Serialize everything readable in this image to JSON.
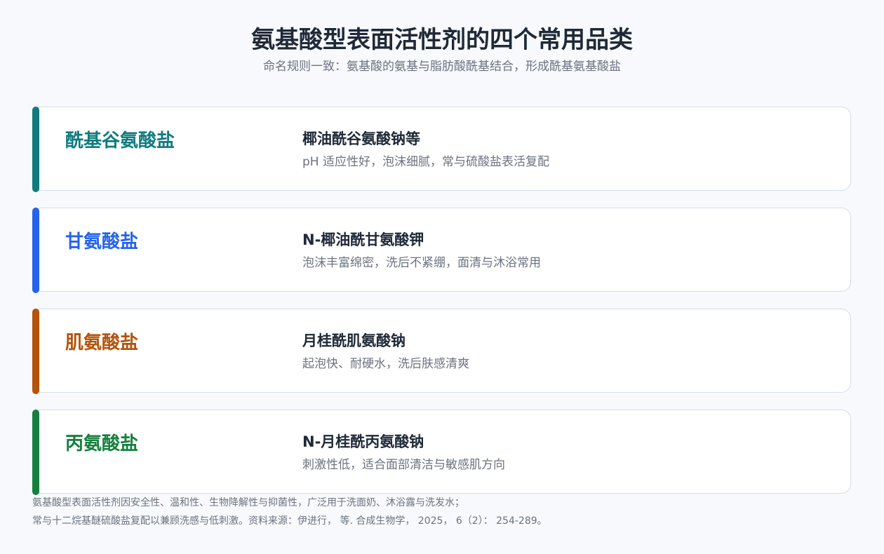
{
  "title": "氨基酸型表面活性剂的四个常用品类",
  "subtitle": "命名规则一致：氨基酸的氨基与脂肪酸酰基结合，形成酰基氨基酸盐",
  "cards": [
    {
      "category": "酰基谷氨酸盐",
      "example": "椰油酰谷氨酸钠等",
      "description": "pH 适应性好，泡沫细腻，常与硫酸盐表活复配",
      "color": "#0f7b7f"
    },
    {
      "category": "甘氨酸盐",
      "example": "N-椰油酰甘氨酸钾",
      "description": "泡沫丰富绵密，洗后不紧绷，面清与沐浴常用",
      "color": "#2563eb"
    },
    {
      "category": "肌氨酸盐",
      "example": "月桂酰肌氨酸钠",
      "description": "起泡快、耐硬水，洗后肤感清爽",
      "color": "#b45309"
    },
    {
      "category": "丙氨酸盐",
      "example": "N-月桂酰丙氨酸钠",
      "description": "刺激性低，适合面部清洁与敏感肌方向",
      "color": "#15803d"
    }
  ],
  "footer": {
    "line1": "氨基酸型表面活性剂因安全性、温和性、生物降解性与抑菌性，广泛用于洗面奶、沐浴露与洗发水；",
    "line2": "常与十二烷基醚硫酸盐复配以兼顾洗感与低刺激。资料来源：伊进行，  等. 合成生物学，  2025，  6（2）：  254-289。"
  }
}
